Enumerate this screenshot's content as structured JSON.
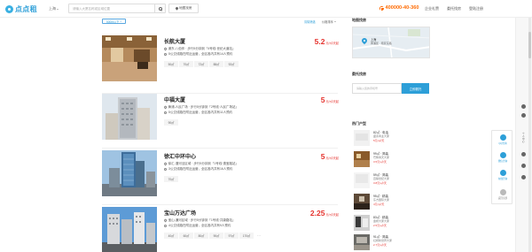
{
  "header": {
    "logo_text": "点点租",
    "city": "上海",
    "search_placeholder": "请输入大厦名称或区域位置",
    "map_find_label": "地图找房",
    "phone": "400000-40-360",
    "nav": [
      "企业礼赞",
      "委托找房",
      "登陆注册"
    ]
  },
  "filter": {
    "active_tag": "500m以下",
    "clear_label": "清除筛选",
    "sort_label": "价格排序"
  },
  "listings": [
    {
      "name": "长航大厦",
      "location": "浦东-八佰伴 · 步行5分钟到「4号线·世纪大道站」",
      "subway": "5公交线路在附近运营，全区各内共有14人预约",
      "price": "5.2",
      "price_unit": "元/㎡/天起",
      "areas": [
        "50㎡",
        "70㎡",
        "72㎡",
        "88㎡",
        "92㎡"
      ]
    },
    {
      "name": "中福大厦",
      "location": "黄浦-人民广场 · 步行5分钟到「2号线·人民广场站」",
      "subway": "5公交线路在附近运营，全区各内共有11人预约",
      "price": "5",
      "price_unit": "元/㎡/天起",
      "areas": [
        "90㎡"
      ]
    },
    {
      "name": "徐汇中环中心",
      "location": "徐汇-漕河泾区域 · 步行5分钟到「1号线·漕宝路站」",
      "subway": "3公交线路在附近运营，全区各内共有16人预约",
      "price": "5",
      "price_unit": "元/㎡/天起",
      "areas": [
        "70㎡"
      ]
    },
    {
      "name": "宝山万达广场",
      "location": "宝山-通河区域 · 步行5分钟到「1号线·共康路站」",
      "subway": "4公交线路在附近运营，全区各内共有9人预约",
      "price": "2.25",
      "price_unit": "元/㎡/天起",
      "areas": [
        "40㎡",
        "60㎡",
        "80㎡",
        "90㎡",
        "97㎡",
        "170㎡"
      ],
      "more": "···"
    }
  ],
  "sidebar": {
    "map_title": "地图找房",
    "map_city": "上海",
    "map_district": "黄浦区 · 南京东路",
    "commission_title": "委托找房",
    "commission_placeholder": "请输入您的手机号",
    "commission_button": "立即委托",
    "hot_title": "热门户型",
    "hot_items": [
      {
        "line1": "82㎡ · 电话",
        "line2": "盛泰商业大厦",
        "line3": "5元/㎡/天"
      },
      {
        "line1": "99㎡ · 简装",
        "line2": "巴黎春天大厦",
        "line3": "3.5元/㎡/天"
      },
      {
        "line1": "59㎡ · 简装",
        "line2": "百联世纪大厦",
        "line3": "3.8元/㎡/天"
      },
      {
        "line1": "95㎡ · 精装",
        "line2": "东方国际大厦",
        "line3": "4元/㎡/天"
      },
      {
        "line1": "83㎡ · 精装",
        "line2": "金桥大厦大厦",
        "line3": "2.5元/㎡/天"
      },
      {
        "line1": "91㎡ · 简装",
        "line2": "虹桥新世界大厦",
        "line3": "2.7元/㎡/天"
      }
    ]
  },
  "float_bar": {
    "items": [
      "QQ咨询",
      "微信咨询",
      "在线咨询",
      "返回顶部"
    ]
  },
  "edge": {
    "text": "个人中心"
  },
  "colors": {
    "brand": "#2d9fd8",
    "price": "#e5322d",
    "phone": "#ff6a00"
  }
}
